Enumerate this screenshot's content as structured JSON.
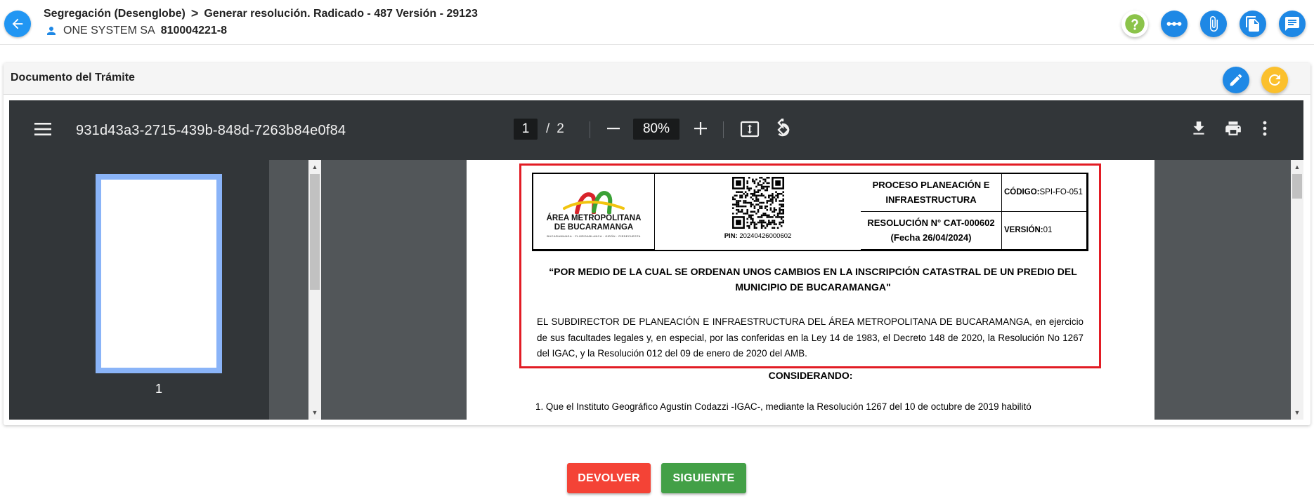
{
  "header": {
    "breadcrumb_root": "Segregación (Desenglobe)",
    "breadcrumb_separator": ">",
    "breadcrumb_current": "Generar resolución. Radicado - 487 Versión - 29123",
    "owner_name": "ONE SYSTEM SA",
    "owner_nit": "810004221-8",
    "actions": [
      "help-icon",
      "flow-icon",
      "attachment-icon",
      "copy-document-icon",
      "notes-icon"
    ]
  },
  "card": {
    "title": "Documento del Trámite",
    "actions": [
      "edit-icon",
      "refresh-icon"
    ]
  },
  "pdf_viewer": {
    "file_name": "931d43a3-2715-439b-848d-7263b84e0f84",
    "current_page": "1",
    "page_separator": "/",
    "total_pages": "2",
    "zoom": "80%",
    "thumbnail_label": "1"
  },
  "document": {
    "process_title": "PROCESO PLANEACIÓN E INFRAESTRUCTURA",
    "resolution_number": "RESOLUCIÓN N° CAT-000602",
    "resolution_date": "(Fecha 26/04/2024)",
    "codigo_label": "CÓDIGO:",
    "codigo_value": "SPI-FO-051",
    "version_label": "VERSIÓN:",
    "version_value": "01",
    "pin_label": "PIN:",
    "pin_value": "20240426000602",
    "logo_line1": "ÁREA METROPOLITANA",
    "logo_line2": "DE BUCARAMANGA",
    "logo_subline": "BUCARAMANGA · FLORIDABLANCA · GIRÓN · PIEDECUESTA",
    "heading": "“POR MEDIO DE LA CUAL SE ORDENAN UNOS CAMBIOS EN LA INSCRIPCIÓN CATASTRAL DE UN PREDIO DEL MUNICIPIO DE BUCARAMANGA\"",
    "paragraph": "EL SUBDIRECTOR DE PLANEACIÓN E INFRAESTRUCTURA DEL ÁREA METROPOLITANA DE BUCARAMANGA, en ejercicio de sus facultades legales y, en especial, por las conferidas en la Ley 14 de 1983, el Decreto 148 de 2020, la Resolución No 1267 del IGAC, y la Resolución 012 del 09 de enero de 2020 del AMB.",
    "considerando": "CONSIDERANDO:",
    "item_1": "1. Que el Instituto Geográfico Agustín Codazzi -IGAC-, mediante la Resolución 1267 del 10 de octubre de 2019 habilitó"
  },
  "footer": {
    "devolver_label": "DEVOLVER",
    "siguiente_label": "SIGUIENTE"
  },
  "colors": {
    "primary": "#1e88e5",
    "help": "#8bc34a",
    "refresh": "#fbc02d",
    "devolver": "#f44336",
    "siguiente": "#43a047",
    "highlight_border": "#e21c24"
  }
}
